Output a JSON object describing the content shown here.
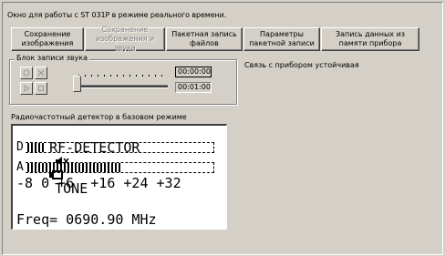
{
  "window": {
    "title": "Окно для работы с ST 031P в режиме реального времени."
  },
  "toolbar": {
    "buttons": [
      {
        "label": "Сохранение\nизображения",
        "enabled": true
      },
      {
        "label": "Сохранение\nизображения и звука",
        "enabled": false
      },
      {
        "label": "Пакетная запись\nфайлов",
        "enabled": true
      },
      {
        "label": "Параметры\nпакетной записи",
        "enabled": true
      },
      {
        "label": "Запись данных из\nпамяти прибора",
        "enabled": true
      }
    ]
  },
  "sound_block": {
    "label": "Блок записи звука",
    "icons": [
      "record-icon",
      "stop-icon",
      "play-icon",
      "pause-icon"
    ],
    "position_time": "00:00:00",
    "total_time": "00:01:00",
    "slider_fraction": 0.0
  },
  "status": {
    "text": "Связь с прибором устойчивая"
  },
  "detector": {
    "label": "Радиочастотный детектор в базовом режиме",
    "header_text": "RF-DETECTOR",
    "mode_text": "TONE",
    "icons": [
      "speaker-muted-icon",
      "battery-icon"
    ],
    "bar_d_letter": "D",
    "bar_d_level": 5,
    "bar_a_letter": "A",
    "bar_a_level": 26,
    "scale": "-8 0 +6  +16 +24 +32",
    "frequency": "Freq= 0690.90 MHz"
  },
  "colors": {
    "window_bg": "#d4d0c8",
    "lcd_bg": "#ffffff",
    "lcd_fg": "#000000",
    "disabled_text": "#808080"
  }
}
